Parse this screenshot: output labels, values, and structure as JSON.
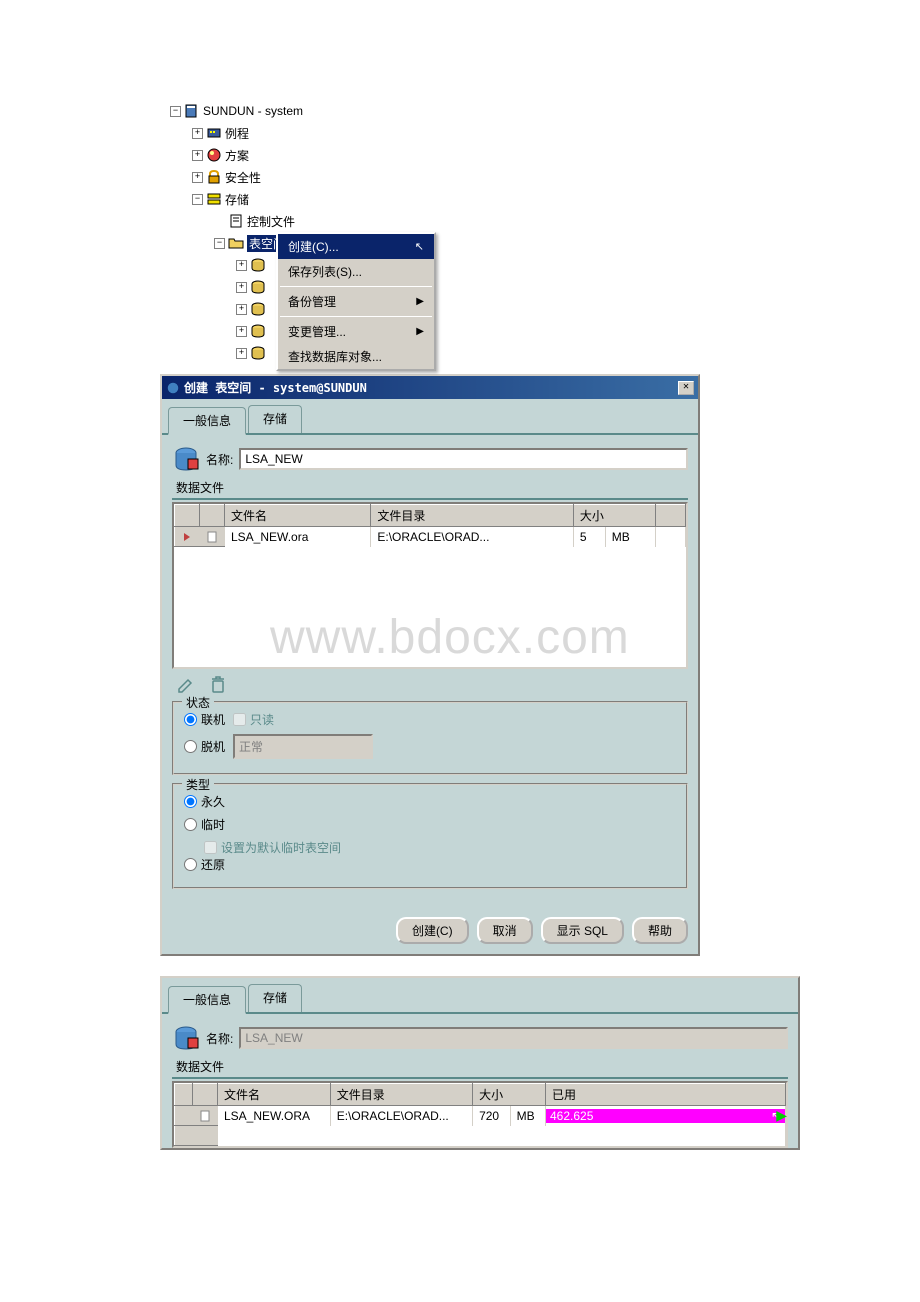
{
  "tree": {
    "root": "SUNDUN - system",
    "nodes": {
      "instance": "例程",
      "schema": "方案",
      "security": "安全性",
      "storage": "存储",
      "control_files": "控制文件",
      "tablespace": "表空间"
    }
  },
  "context_menu": {
    "create": "创建(C)...",
    "save_list": "保存列表(S)...",
    "backup_mgmt": "备份管理",
    "change_mgmt": "变更管理...",
    "find_db_obj": "查找数据库对象..."
  },
  "dialog": {
    "title": "创建 表空间 - system@SUNDUN",
    "tabs": {
      "general": "一般信息",
      "storage": "存储"
    },
    "name_label": "名称:",
    "name_value": "LSA_NEW",
    "datafiles_label": "数据文件",
    "table": {
      "headers": {
        "filename": "文件名",
        "filedir": "文件目录",
        "size": "大小",
        "unit": "",
        "used": "已用"
      },
      "row1": {
        "filename": "LSA_NEW.ora",
        "filedir": "E:\\ORACLE\\ORAD...",
        "size": "5",
        "unit": "MB"
      }
    },
    "status": {
      "title": "状态",
      "online": "联机",
      "readonly": "只读",
      "offline": "脱机",
      "mode": "正常"
    },
    "type": {
      "title": "类型",
      "permanent": "永久",
      "temporary": "临时",
      "set_default_temp": "设置为默认临时表空间",
      "undo": "还原"
    },
    "buttons": {
      "create": "创建(C)",
      "cancel": "取消",
      "show_sql": "显示 SQL",
      "help": "帮助"
    }
  },
  "bottom": {
    "name_value": "LSA_NEW",
    "table": {
      "row1": {
        "filename": "LSA_NEW.ORA",
        "filedir": "E:\\ORACLE\\ORAD...",
        "size": "720",
        "unit": "MB",
        "used": "462.625"
      }
    }
  },
  "watermark": "www.bdocx.com"
}
